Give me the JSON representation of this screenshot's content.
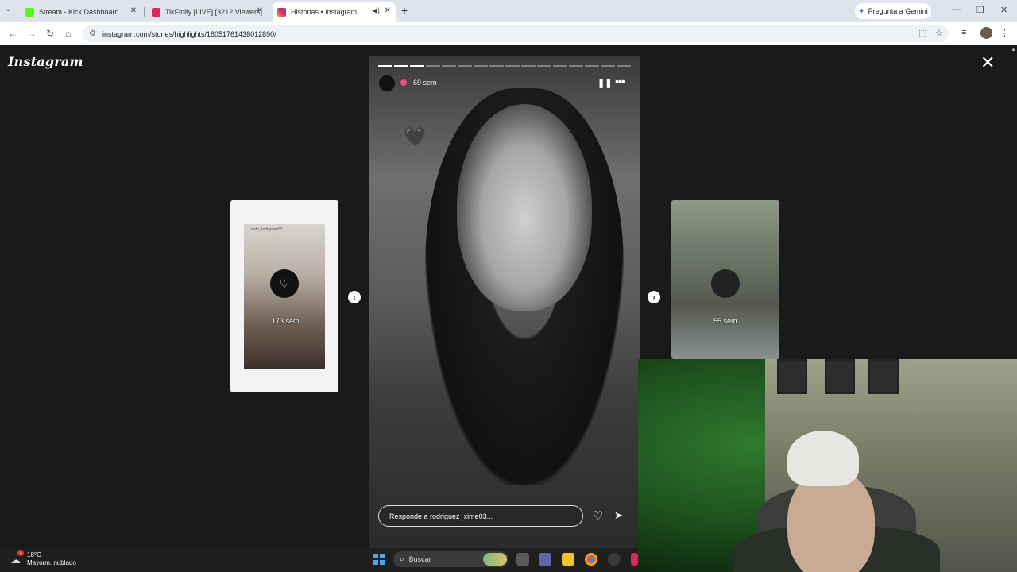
{
  "browser": {
    "tabs": [
      {
        "title": "Stream - Kick Dashboard",
        "favicon_color": "#53fc18"
      },
      {
        "title": "TikFinity [LIVE] [3212 Viewers]",
        "favicon_color": "#e0245e"
      },
      {
        "title": "Historias • Instagram",
        "favicon_color": "#e1306c"
      }
    ],
    "new_tab": "+",
    "gemini_label": "Pregunta a Gemini",
    "url": "instagram.com/stories/highlights/18051761438012890/"
  },
  "instagram": {
    "logo": "Instagram",
    "close": "✕",
    "prev_story": {
      "time": "173 sem",
      "username": "rodri_rodriguez03"
    },
    "next_story": {
      "time": "55 sem"
    },
    "current_story": {
      "time": "69 sem",
      "progress_segments": 16,
      "progress_current": 3,
      "reply_placeholder": "Responde a rodriguez_xime03..."
    }
  },
  "taskbar": {
    "weather_temp": "18°C",
    "weather_desc": "Mayorm. nublado",
    "weather_badge": "1",
    "search_placeholder": "Buscar"
  },
  "icons": {
    "back": "←",
    "forward": "→",
    "reload": "↻",
    "home": "⌂",
    "pause": "❚❚",
    "more": "•••",
    "heart": "♡",
    "send": "➤",
    "heart_filled": "🖤"
  },
  "colors": {
    "background": "#1a1a1a",
    "reply_border": "#dddddd",
    "story_dot": "#e8507a"
  }
}
